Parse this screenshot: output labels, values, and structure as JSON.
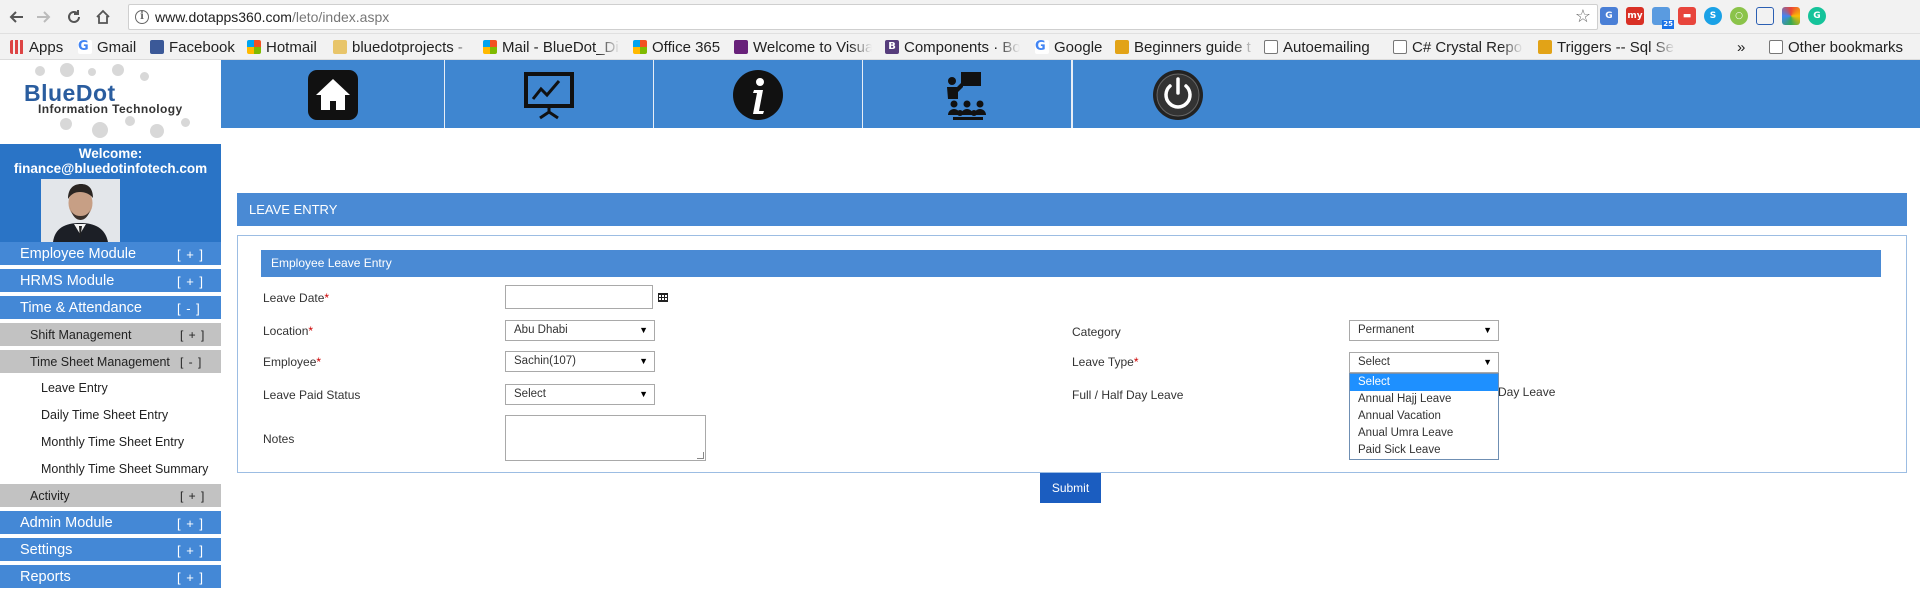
{
  "browser": {
    "url_host": "www.dotapps360.com",
    "url_path": "/leto/index.aspx",
    "bookmarks": [
      "Apps",
      "Gmail",
      "Facebook",
      "Hotmail",
      "bluedotprojects -",
      "Mail - BlueDot_Di",
      "Office 365",
      "Welcome to Visua",
      "Components · Bo",
      "Google",
      "Beginners guide t",
      "Autoemailing",
      "C# Crystal Report",
      "Triggers -- Sql Se",
      "»",
      "Other bookmarks"
    ],
    "ext_badge": "25",
    "ext_my": "my"
  },
  "logo": {
    "line1": "BlueDot",
    "line2": "Information Technology"
  },
  "topnav": [
    "home-icon",
    "dashboard-chart-icon",
    "info-icon",
    "training-icon",
    "power-icon"
  ],
  "sidebar": {
    "welcome_label": "Welcome:",
    "user_email": "finance@bluedotinfotech.com",
    "menu": [
      {
        "label": "Employee Module",
        "toggle": "[ + ]"
      },
      {
        "label": "HRMS Module",
        "toggle": "[ + ]"
      },
      {
        "label": "Time & Attendance",
        "toggle": "[ - ]"
      },
      {
        "label": "Shift Management",
        "toggle": "[ + ]"
      },
      {
        "label": "Time Sheet Management",
        "toggle": "[ - ]"
      },
      {
        "label": "Leave Entry"
      },
      {
        "label": "Daily Time Sheet Entry"
      },
      {
        "label": "Monthly Time Sheet Entry"
      },
      {
        "label": "Monthly Time Sheet Summary"
      },
      {
        "label": "Activity",
        "toggle": "[ + ]"
      },
      {
        "label": "Admin Module",
        "toggle": "[ + ]"
      },
      {
        "label": "Settings",
        "toggle": "[ + ]"
      },
      {
        "label": "Reports",
        "toggle": "[ + ]"
      }
    ]
  },
  "page": {
    "section_title": "LEAVE ENTRY",
    "panel_title": "Employee Leave Entry",
    "fields": {
      "leave_date": {
        "label": "Leave Date",
        "value": ""
      },
      "location": {
        "label": "Location",
        "value": "Abu Dhabi"
      },
      "employee": {
        "label": "Employee",
        "value": "Sachin(107)"
      },
      "leave_paid_status": {
        "label": "Leave Paid Status",
        "value": "Select"
      },
      "notes": {
        "label": "Notes",
        "value": ""
      },
      "category": {
        "label": "Category",
        "value": "Permanent"
      },
      "leave_type": {
        "label": "Leave Type",
        "value": "Select"
      },
      "full_half_day": {
        "label": "Full / Half Day Leave",
        "partial_visible_text": "Day Leave"
      }
    },
    "required_marker": "*",
    "leave_type_options": [
      "Select",
      "Annual Hajj Leave",
      "Annual Vacation",
      "Anual Umra Leave",
      "Paid Sick Leave"
    ],
    "submit_label": "Submit"
  }
}
